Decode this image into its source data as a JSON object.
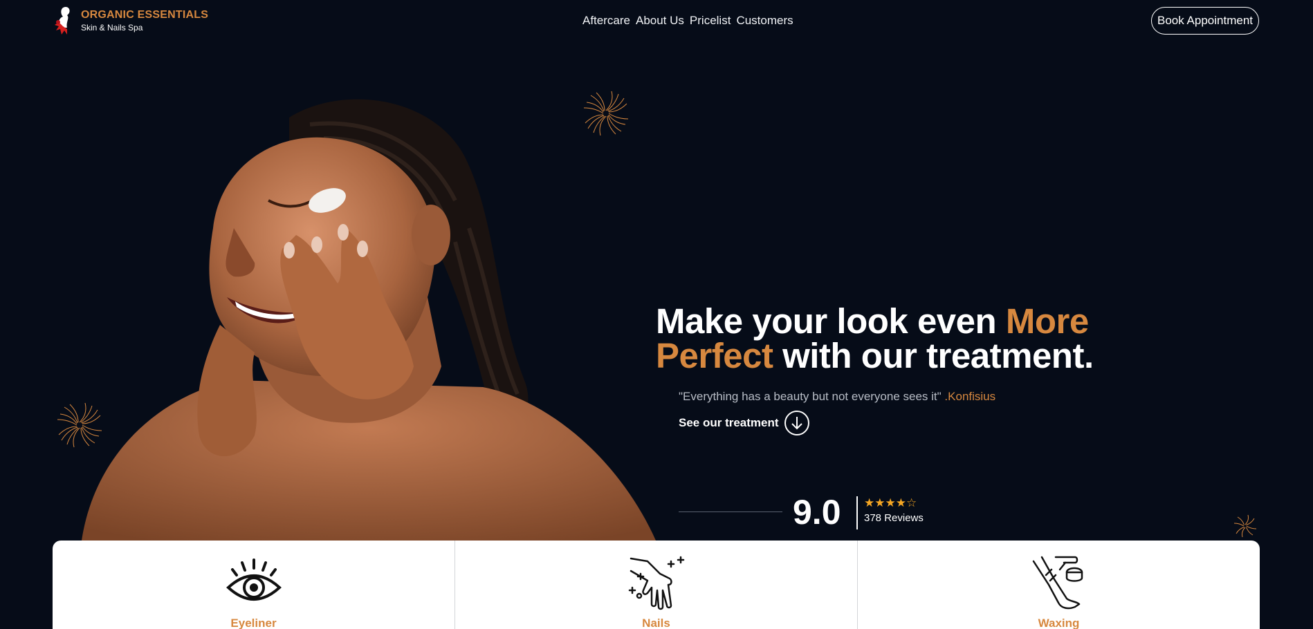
{
  "header": {
    "brand_name": "ORGANIC ESSENTIALS",
    "brand_subtitle": "Skin & Nails Spa",
    "nav": [
      "Aftercare",
      "About Us",
      "Pricelist",
      "Customers"
    ],
    "cta_label": "Book Appointment"
  },
  "hero": {
    "headline_part1": "Make your look even ",
    "headline_accent1": "More",
    "headline_accent2": "Perfect",
    "headline_part2": " with our treatment.",
    "quote_text": "\"Everything has a beauty but not everyone sees it\"",
    "quote_author": ".Konfisius",
    "see_treatment_label": "See our treatment",
    "rating_score": "9.0",
    "rating_stars": 4.5,
    "rating_stars_text": "★★★★☆",
    "rating_reviews": "378 Reviews"
  },
  "services": [
    {
      "label": "Eyeliner",
      "icon": "eye-icon"
    },
    {
      "label": "Nails",
      "icon": "hand-nails-icon"
    },
    {
      "label": "Waxing",
      "icon": "leg-waxing-icon"
    }
  ],
  "colors": {
    "background": "#060c18",
    "accent": "#d7883f",
    "text": "#ffffff",
    "star": "#f5a623",
    "card": "#ffffff"
  }
}
